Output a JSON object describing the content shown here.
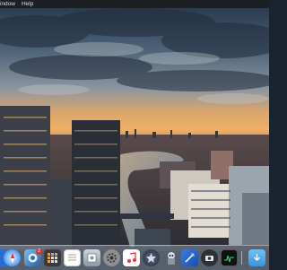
{
  "menubar": {
    "items": [
      "indow",
      "Help"
    ]
  },
  "wallpaper": {
    "subject": "city-skyline-sunset"
  },
  "dock": {
    "items": [
      {
        "name": "partial-app-icon"
      },
      {
        "name": "safari-icon"
      },
      {
        "name": "photo-app-icon",
        "badge": "2"
      },
      {
        "name": "calculator-icon"
      },
      {
        "name": "notes-icon"
      },
      {
        "name": "preview-icon"
      },
      {
        "name": "system-prefs-icon"
      },
      {
        "name": "music-icon"
      },
      {
        "name": "launchpad-icon"
      },
      {
        "name": "automator-icon"
      },
      {
        "name": "xcode-icon"
      },
      {
        "name": "screenshot-icon"
      },
      {
        "name": "activity-monitor-icon"
      },
      {
        "name": "downloads-folder-icon"
      }
    ]
  },
  "colors": {
    "menubar_bg": "#1c1f24",
    "sky_top": "#2c3e55",
    "sunset": "#e8a15a",
    "river": "#6d8ea8"
  }
}
